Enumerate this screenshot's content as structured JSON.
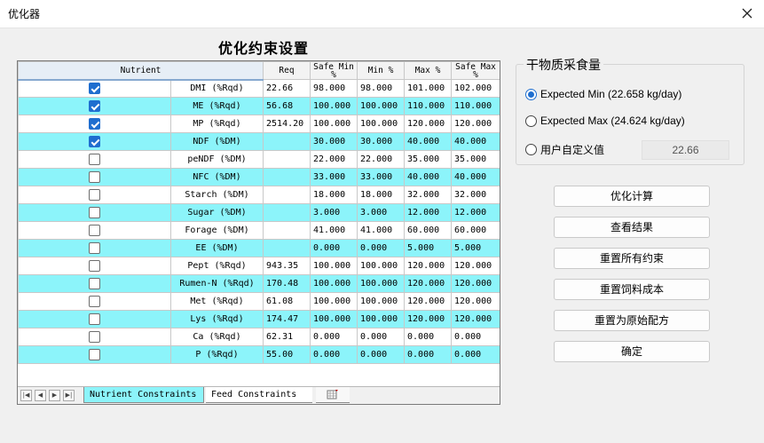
{
  "window": {
    "title": "优化器"
  },
  "heading": "优化约束设置",
  "grid": {
    "columns": [
      "Nutrient",
      "Req",
      "Safe Min %",
      "Min %",
      "Max %",
      "Safe Max %"
    ],
    "rows": [
      {
        "checked": true,
        "name": "DMI (%Rqd)",
        "req": "22.66",
        "safe_min": "98.000",
        "min": "98.000",
        "max": "101.000",
        "safe_max": "102.000"
      },
      {
        "checked": true,
        "name": "ME (%Rqd)",
        "req": "56.68",
        "safe_min": "100.000",
        "min": "100.000",
        "max": "110.000",
        "safe_max": "110.000"
      },
      {
        "checked": true,
        "name": "MP (%Rqd)",
        "req": "2514.20",
        "safe_min": "100.000",
        "min": "100.000",
        "max": "120.000",
        "safe_max": "120.000"
      },
      {
        "checked": true,
        "name": "NDF (%DM)",
        "req": "",
        "safe_min": "30.000",
        "min": "30.000",
        "max": "40.000",
        "safe_max": "40.000"
      },
      {
        "checked": false,
        "name": "peNDF (%DM)",
        "req": "",
        "safe_min": "22.000",
        "min": "22.000",
        "max": "35.000",
        "safe_max": "35.000"
      },
      {
        "checked": false,
        "name": "NFC (%DM)",
        "req": "",
        "safe_min": "33.000",
        "min": "33.000",
        "max": "40.000",
        "safe_max": "40.000"
      },
      {
        "checked": false,
        "name": "Starch (%DM)",
        "req": "",
        "safe_min": "18.000",
        "min": "18.000",
        "max": "32.000",
        "safe_max": "32.000"
      },
      {
        "checked": false,
        "name": "Sugar (%DM)",
        "req": "",
        "safe_min": "3.000",
        "min": "3.000",
        "max": "12.000",
        "safe_max": "12.000"
      },
      {
        "checked": false,
        "name": "Forage (%DM)",
        "req": "",
        "safe_min": "41.000",
        "min": "41.000",
        "max": "60.000",
        "safe_max": "60.000"
      },
      {
        "checked": false,
        "name": "EE (%DM)",
        "req": "",
        "safe_min": "0.000",
        "min": "0.000",
        "max": "5.000",
        "safe_max": "5.000"
      },
      {
        "checked": false,
        "name": "Pept (%Rqd)",
        "req": "943.35",
        "safe_min": "100.000",
        "min": "100.000",
        "max": "120.000",
        "safe_max": "120.000"
      },
      {
        "checked": false,
        "name": "Rumen-N (%Rqd)",
        "req": "170.48",
        "safe_min": "100.000",
        "min": "100.000",
        "max": "120.000",
        "safe_max": "120.000"
      },
      {
        "checked": false,
        "name": "Met (%Rqd)",
        "req": "61.08",
        "safe_min": "100.000",
        "min": "100.000",
        "max": "120.000",
        "safe_max": "120.000"
      },
      {
        "checked": false,
        "name": "Lys (%Rqd)",
        "req": "174.47",
        "safe_min": "100.000",
        "min": "100.000",
        "max": "120.000",
        "safe_max": "120.000"
      },
      {
        "checked": false,
        "name": "Ca (%Rqd)",
        "req": "62.31",
        "safe_min": "0.000",
        "min": "0.000",
        "max": "0.000",
        "safe_max": "0.000"
      },
      {
        "checked": false,
        "name": "P (%Rqd)",
        "req": "55.00",
        "safe_min": "0.000",
        "min": "0.000",
        "max": "0.000",
        "safe_max": "0.000"
      }
    ],
    "row_highlight_color": "#8cf4fa"
  },
  "tabs": {
    "nutrient_label": "Nutrient Constraints",
    "feed_label": "Feed Constraints"
  },
  "dm_intake": {
    "legend": "干物质采食量",
    "options": [
      {
        "label": "Expected Min (22.658 kg/day)",
        "selected": true
      },
      {
        "label": "Expected Max (24.624 kg/day)",
        "selected": false
      },
      {
        "label": "用户自定义值",
        "selected": false
      }
    ],
    "custom_value": "22.66"
  },
  "buttons": {
    "optimize": "优化计算",
    "view_results": "查看结果",
    "reset_constraints": "重置所有约束",
    "reset_feed_cost": "重置饲料成本",
    "reset_original": "重置为原始配方",
    "ok": "确定"
  },
  "colors": {
    "accent": "#1f6ecf",
    "highlight": "#8cf4fa"
  }
}
